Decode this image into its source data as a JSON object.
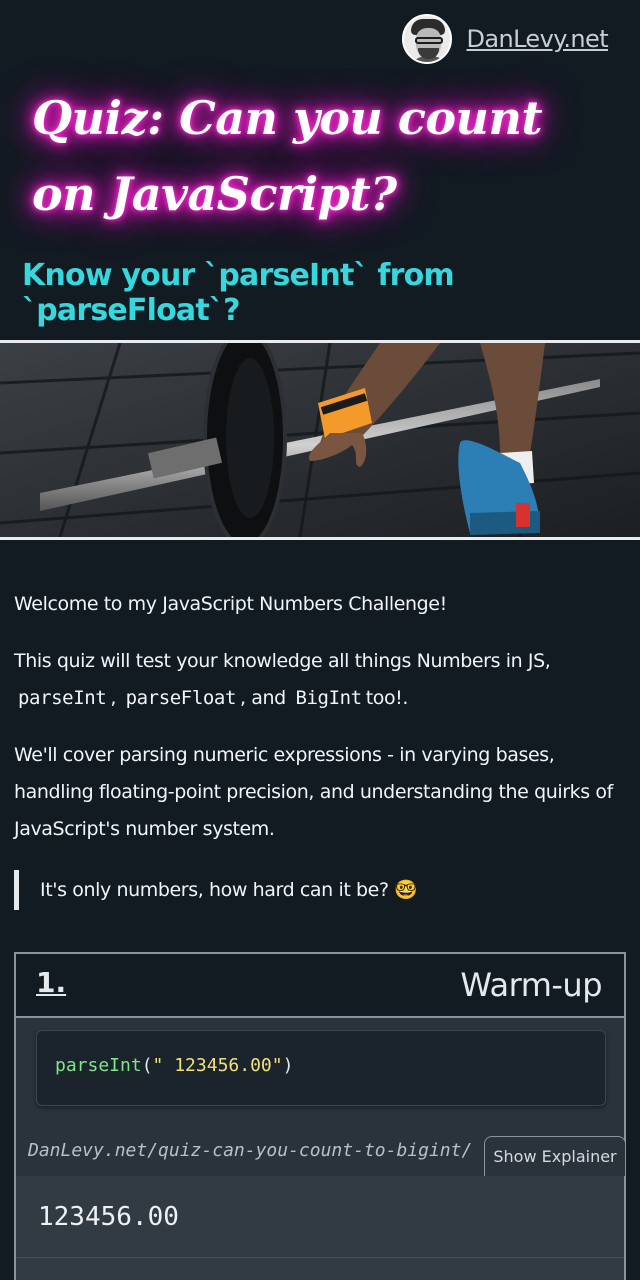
{
  "site": {
    "name": "DanLevy.net",
    "avatar_icon": "author-avatar"
  },
  "hero": {
    "title": "Quiz: Can you count on JavaScript?",
    "subtitle": "Know your `parseInt` from `parseFloat`?",
    "image_icon": "barbell-deadlift-photo",
    "colors": {
      "title_glow": "#ff1fd0",
      "subtitle": "#37d7de",
      "background": "#121a22"
    }
  },
  "intro": {
    "p1": "Welcome to my JavaScript Numbers Challenge!",
    "p2_text": "This quiz will test your knowledge all things Numbers in JS,",
    "p2_code1": "parseInt",
    "p2_sep1": ",",
    "p2_code2": "parseFloat",
    "p2_sep2": ", and",
    "p2_code3": "BigInt",
    "p2_tail": "too!.",
    "p3": "We'll cover parsing numeric expressions - in varying bases, handling floating-point precision, and understanding the quirks of JavaScript's number system.",
    "quote": "It's only numbers, how hard can it be? 🤓"
  },
  "challenge": {
    "number": "1.",
    "title": "Warm-up",
    "code": {
      "fn": "parseInt",
      "open": "(",
      "arg": "\" 123456.00\"",
      "close": ")"
    },
    "url": "DanLevy.net/quiz-can-you-count-to-bigint/",
    "explainer_label": "Show Explainer",
    "options": [
      "123456.00"
    ]
  }
}
